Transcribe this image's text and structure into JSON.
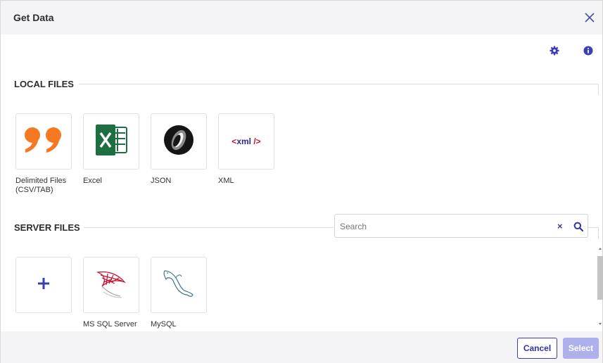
{
  "header": {
    "title": "Get Data",
    "close_icon": "close-icon"
  },
  "toolbar": {
    "settings_icon": "gear-icon",
    "info_icon": "info-icon"
  },
  "local_files": {
    "label": "LOCAL FILES",
    "items": [
      {
        "label": "Delimited Files (CSV/TAB)",
        "icon": "quote-icon"
      },
      {
        "label": "Excel",
        "icon": "excel-icon"
      },
      {
        "label": "JSON",
        "icon": "json-icon"
      },
      {
        "label": "XML",
        "icon": "xml-icon",
        "icon_text": "<xml />"
      }
    ]
  },
  "server_files": {
    "label": "SERVER FILES",
    "search": {
      "placeholder": "Search",
      "value": "",
      "clear_glyph": "×"
    },
    "items": [
      {
        "label": "",
        "icon": "plus-icon"
      },
      {
        "label": "MS SQL Server JDBC/Azure D...",
        "icon": "mssql-icon"
      },
      {
        "label": "MySQL",
        "icon": "mysql-icon"
      }
    ]
  },
  "footer": {
    "cancel_label": "Cancel",
    "select_label": "Select"
  },
  "colors": {
    "accent": "#3b3fb2",
    "accent_disabled": "#aeb0ec",
    "quote_orange": "#f47920",
    "excel_green": "#1d6f42",
    "mssql_red": "#c8102e",
    "mysql_blue": "#4a7a96"
  }
}
